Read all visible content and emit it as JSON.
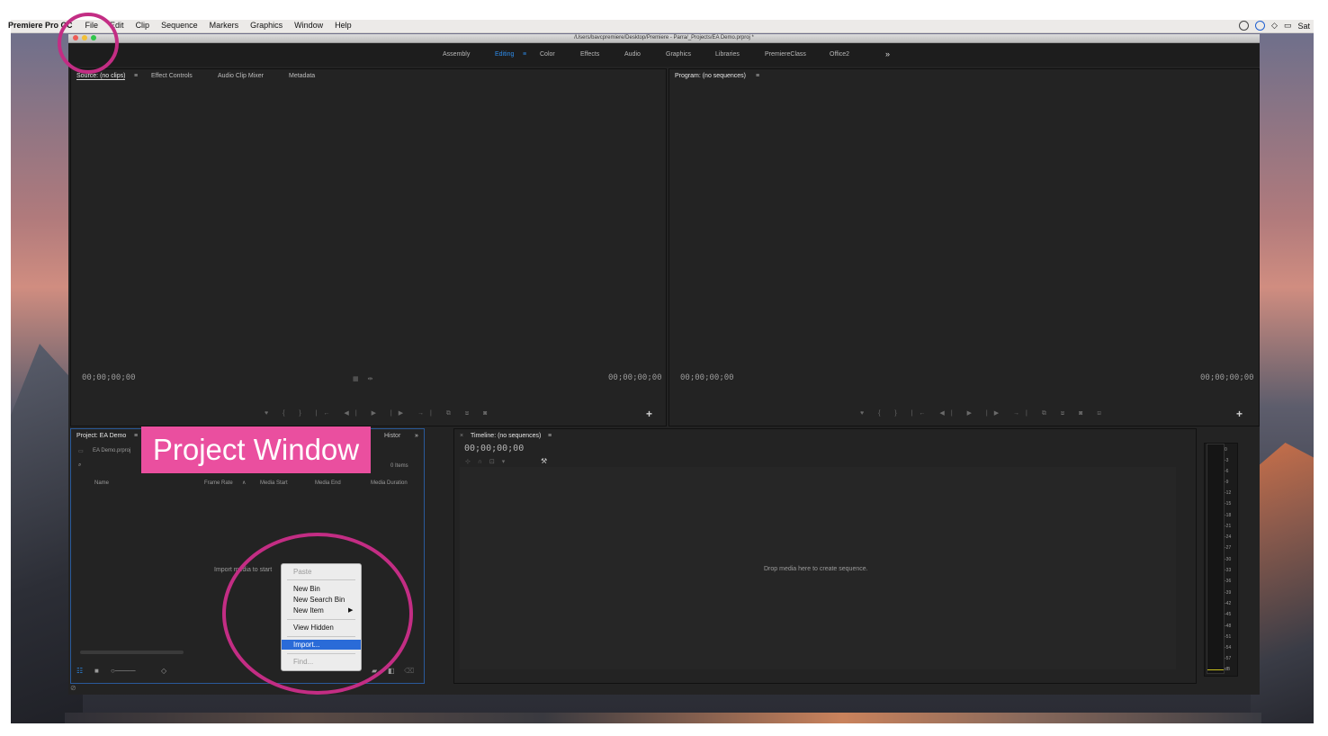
{
  "menubar": {
    "app": "Premiere Pro CC",
    "items": [
      "File",
      "Edit",
      "Clip",
      "Sequence",
      "Markers",
      "Graphics",
      "Window",
      "Help"
    ],
    "clock": "Sat"
  },
  "window": {
    "path": "/Users/bavcpremiere/Desktop/Premiere - Parra/_Projects/EA Demo.prproj *",
    "traffic_lights": [
      "#ee5b55",
      "#f2bf36",
      "#2ec54a"
    ]
  },
  "workspaces": [
    "Assembly",
    "Editing",
    "Color",
    "Effects",
    "Audio",
    "Graphics",
    "Libraries",
    "PremiereClass",
    "Office2"
  ],
  "workspace_active": "Editing",
  "workspace_more": "»",
  "source_panel": {
    "tabs": [
      "Source: (no clips)",
      "Effect Controls",
      "Audio Clip Mixer",
      "Metadata"
    ],
    "timecode_in": "00;00;00;00",
    "timecode_out": "00;00;00;00"
  },
  "program_panel": {
    "tab": "Program: (no sequences)",
    "timecode_in": "00;00;00;00",
    "timecode_out": "00;00;00;00"
  },
  "project_panel": {
    "tab": "Project: EA Demo",
    "other_tab": "Histor",
    "file": "EA Demo.prproj",
    "item_count": "0 Items",
    "columns": [
      "Name",
      "Frame Rate",
      "Media Start",
      "Media End",
      "Media Duration"
    ],
    "empty_hint": "Import media to start"
  },
  "timeline_panel": {
    "tab": "Timeline: (no sequences)",
    "timecode": "00;00;00;00",
    "drop_hint": "Drop media here to create sequence."
  },
  "context_menu": {
    "paste": "Paste",
    "new_bin": "New Bin",
    "new_search_bin": "New Search Bin",
    "new_item": "New Item",
    "view_hidden": "View Hidden",
    "import": "Import...",
    "find": "Find..."
  },
  "meter_scale": [
    "0",
    "-3",
    "-6",
    "-9",
    "-12",
    "-15",
    "-18",
    "-21",
    "-24",
    "-27",
    "-30",
    "-33",
    "-36",
    "-39",
    "-42",
    "-45",
    "-48",
    "-51",
    "-54",
    "-57",
    "dB"
  ],
  "annotation": {
    "label": "Project Window",
    "color": "#ea4f9f"
  }
}
